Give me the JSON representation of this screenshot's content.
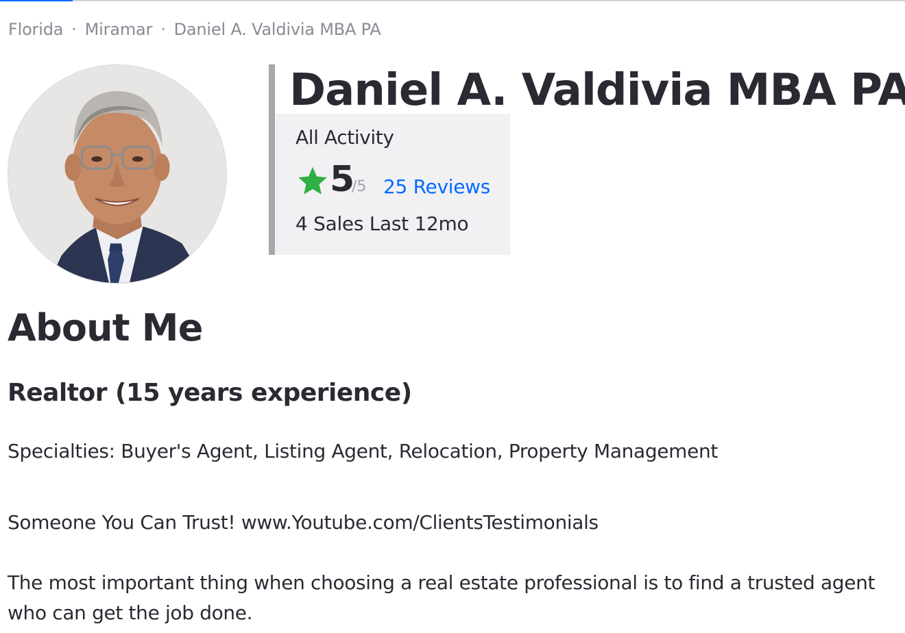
{
  "breadcrumb": {
    "items": [
      "Florida",
      "Miramar",
      "Daniel A. Valdivia MBA PA"
    ],
    "separator": "·"
  },
  "agent": {
    "name": "Daniel A. Valdivia MBA PA",
    "avatar_alt": "Daniel A. Valdivia MBA PA"
  },
  "activity": {
    "title": "All Activity",
    "rating": "5",
    "rating_max": "/5",
    "reviews_link": "25 Reviews",
    "sales": "4 Sales Last 12mo",
    "star_icon": "star-icon",
    "star_color": "#2fb043",
    "link_color": "#006aff"
  },
  "about": {
    "heading": "About Me",
    "subheading": "Realtor (15 years experience)",
    "specialties": "Specialties: Buyer's Agent, Listing Agent, Relocation, Property Management",
    "trust_line": "Someone You Can Trust!  www.Youtube.com/ClientsTestimonials",
    "description": "The most important thing when choosing a real estate professional is to find a trusted agent who can get the job done."
  }
}
